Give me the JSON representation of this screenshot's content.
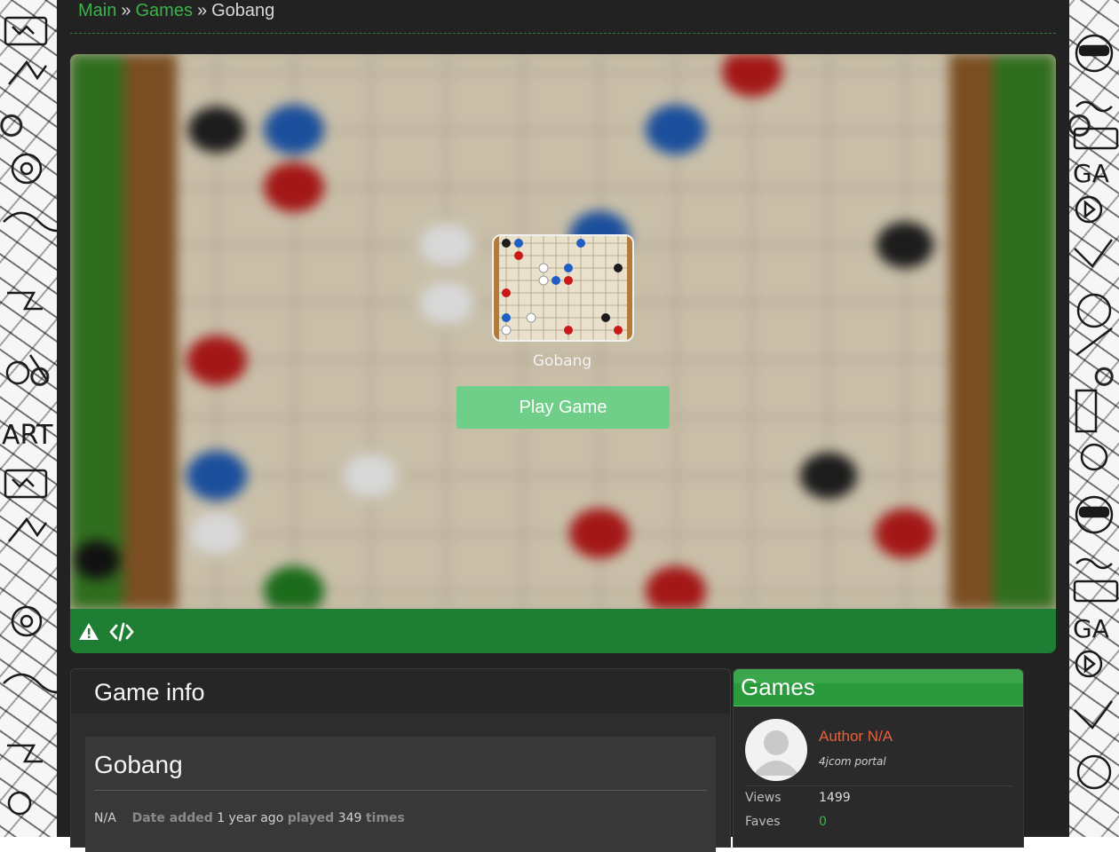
{
  "breadcrumb": {
    "main": "Main",
    "games": "Games",
    "current": "Gobang",
    "separator": "»"
  },
  "game": {
    "title": "Gobang",
    "play_label": "Play Game"
  },
  "toolbar": {
    "icons": [
      "warning-icon",
      "embed-code-icon"
    ]
  },
  "info": {
    "header": "Game info",
    "title": "Gobang",
    "author": "N/A",
    "date_label": "Date added",
    "date_value": "1 year ago",
    "played_label": "played",
    "played_count": "349",
    "times_label": "times"
  },
  "sidebar": {
    "header": "Games",
    "author": "Author N/A",
    "portal": "4jcom portal",
    "views_label": "Views",
    "views_value": "1499",
    "faves_label": "Faves",
    "faves_value": "0"
  },
  "colors": {
    "accent_green": "#3bb34a",
    "toolbar_green": "#1e7e34",
    "play_button": "#6fcf89",
    "author_orange": "#e8603c",
    "panel_dark": "#222222"
  }
}
